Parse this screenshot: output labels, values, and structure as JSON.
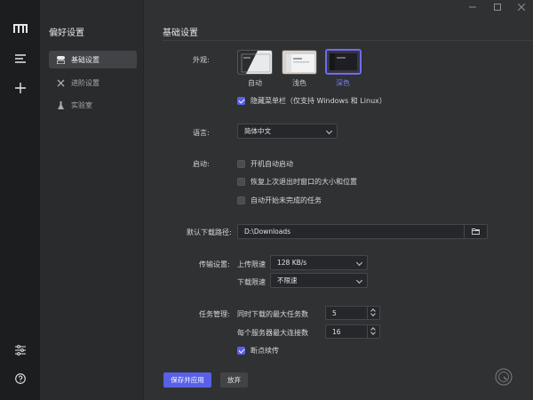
{
  "sidebar_title": "偏好设置",
  "nav": [
    {
      "label": "基础设置",
      "icon": "basic-settings-icon"
    },
    {
      "label": "进阶设置",
      "icon": "tools-icon"
    },
    {
      "label": "实验室",
      "icon": "lab-icon"
    }
  ],
  "section_title": "基础设置",
  "appearance": {
    "label": "外观:",
    "themes": [
      {
        "label": "自动",
        "selected": false
      },
      {
        "label": "浅色",
        "selected": false
      },
      {
        "label": "深色",
        "selected": true
      }
    ],
    "hide_menu_label": "隐藏菜单栏（仅支持 Windows 和 Linux）",
    "hide_menu_checked": true
  },
  "language": {
    "label": "语言:",
    "value": "简体中文"
  },
  "startup": {
    "label": "启动:",
    "options": [
      {
        "label": "开机自动启动",
        "checked": false
      },
      {
        "label": "恢复上次退出时窗口的大小和位置",
        "checked": false
      },
      {
        "label": "自动开始未完成的任务",
        "checked": false
      }
    ]
  },
  "download_path": {
    "label": "默认下载路径:",
    "value": "D:\\Downloads"
  },
  "transfer": {
    "label": "传输设置:",
    "upload_label": "上传限速",
    "upload_value": "128 KB/s",
    "download_label": "下载限速",
    "download_value": "不限速"
  },
  "tasks": {
    "label": "任务管理:",
    "max_tasks_label": "同时下载的最大任务数",
    "max_tasks_value": "5",
    "max_conn_label": "每个服务器最大连接数",
    "max_conn_value": "16",
    "resume_label": "断点续传",
    "resume_checked": true
  },
  "buttons": {
    "save": "保存并应用",
    "discard": "放弃"
  },
  "colors": {
    "accent": "#5a60e6",
    "rail": "#1c1d1f",
    "main": "#2f3133"
  }
}
